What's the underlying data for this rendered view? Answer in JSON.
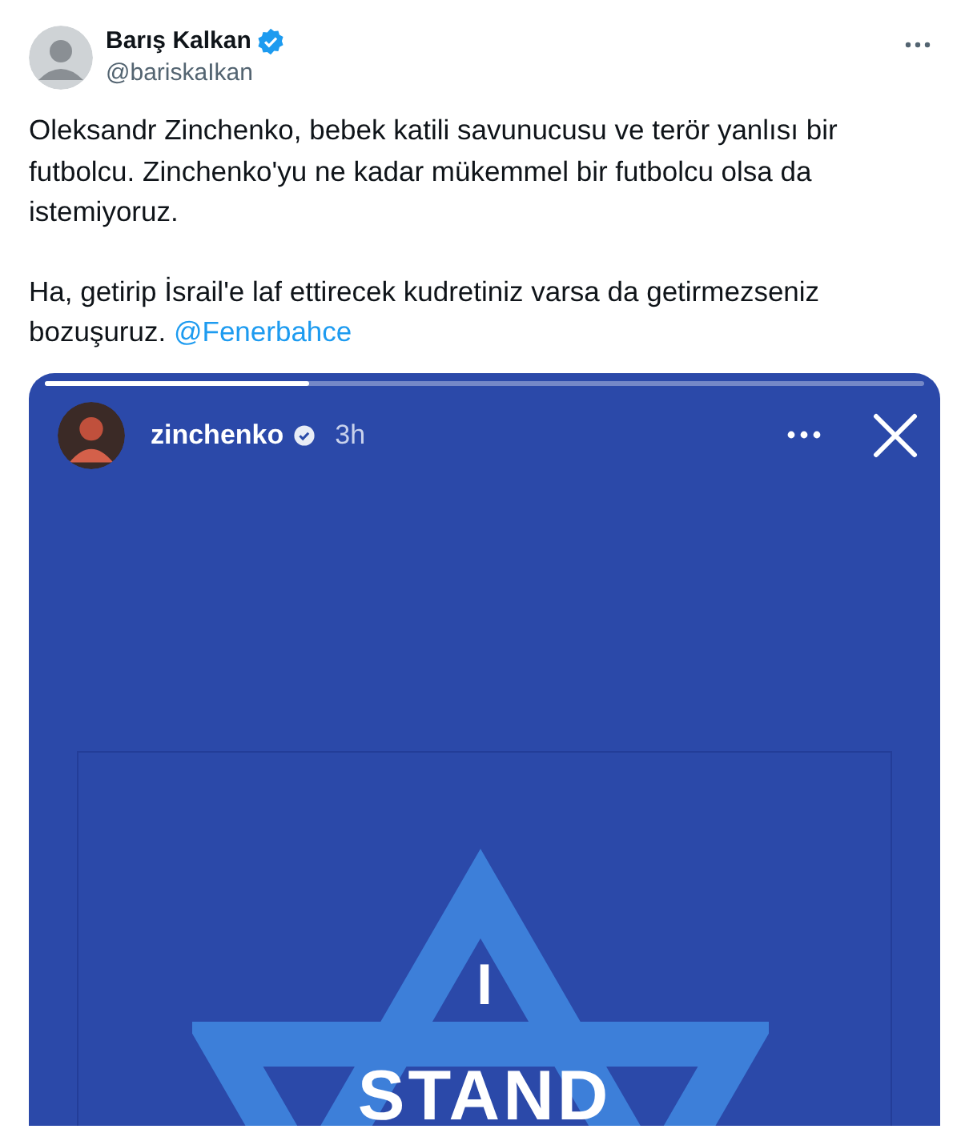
{
  "tweet": {
    "author": {
      "name": "Barış Kalkan",
      "verified": true,
      "handle": "@bariskaIkan"
    },
    "paragraphs": [
      "Oleksandr Zinchenko, bebek katili savunucusu ve terör yanlısı bir futbolcu. Zinchenko'yu ne kadar mükemmel bir futbolcu olsa da istemiyoruz.",
      "Ha, getirip İsrail'e laf ettirecek kudretiniz varsa da getirmezseniz bozuşuruz."
    ],
    "mention": "@Fenerbahce"
  },
  "story": {
    "progress": {
      "level": 0.3
    },
    "user": "zinchenko",
    "verified": true,
    "time": "3h",
    "lines": [
      "I",
      "STAND"
    ]
  }
}
